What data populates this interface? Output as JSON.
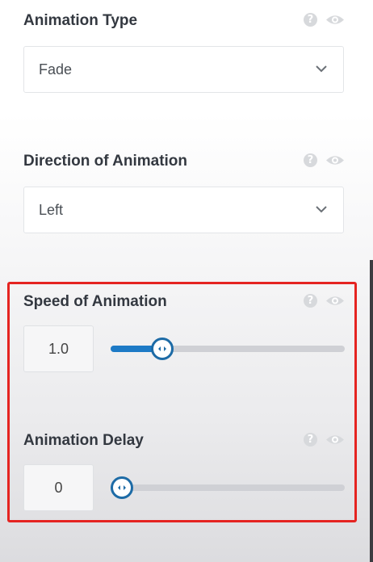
{
  "animation_type": {
    "label": "Animation Type",
    "selected": "Fade",
    "icons": [
      "help-icon",
      "eye-icon"
    ]
  },
  "direction": {
    "label": "Direction of Animation",
    "selected": "Left",
    "icons": [
      "help-icon",
      "eye-icon"
    ]
  },
  "speed": {
    "label": "Speed of Animation",
    "value": "1.0",
    "slider_fraction": 0.19,
    "icons": [
      "help-icon",
      "eye-icon"
    ]
  },
  "delay": {
    "label": "Animation Delay",
    "value": "0",
    "slider_fraction": 0.0,
    "icons": [
      "help-icon",
      "eye-icon"
    ]
  },
  "help_glyph": "?",
  "colors": {
    "accent": "#1d7ac6",
    "highlight_border": "#e52421",
    "track": "#cfd0d5"
  }
}
